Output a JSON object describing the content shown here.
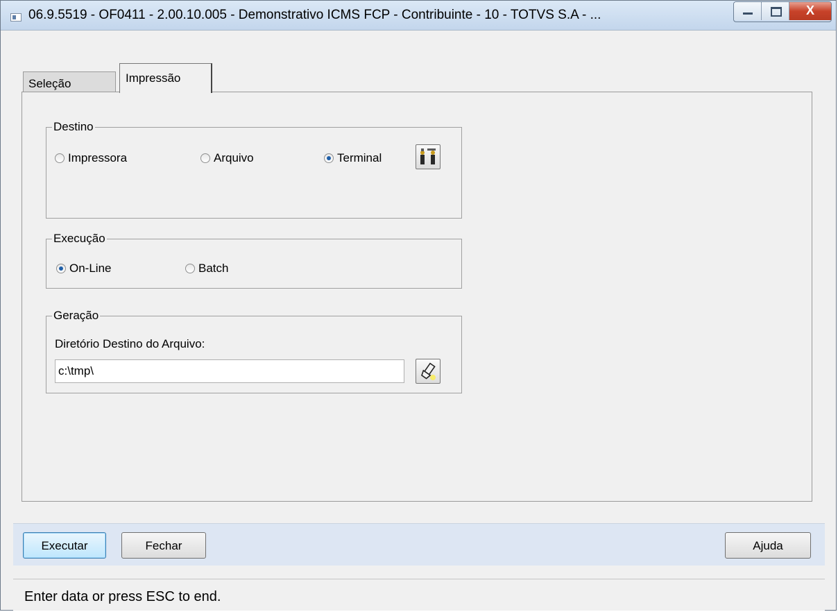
{
  "window": {
    "title": "06.9.5519 - OF0411 - 2.00.10.005 - Demonstrativo ICMS FCP - Contribuinte - 10 - TOTVS S.A - ...",
    "close_glyph": "X"
  },
  "tabs": [
    {
      "label": "Seleção"
    },
    {
      "label": "Impressão"
    }
  ],
  "destino": {
    "legend": "Destino",
    "options": [
      "Impressora",
      "Arquivo",
      "Terminal"
    ],
    "selected": "Terminal",
    "config_icon": "printer-setup-icon"
  },
  "execucao": {
    "legend": "Execução",
    "options": [
      "On-Line",
      "Batch"
    ],
    "selected": "On-Line"
  },
  "geracao": {
    "legend": "Geração",
    "field_label": "Diretório Destino do Arquivo:",
    "directory_value": "c:\\tmp\\",
    "browse_icon": "flashlight-search-icon"
  },
  "buttons": {
    "execute": "Executar",
    "close": "Fechar",
    "help": "Ajuda"
  },
  "status": "Enter data or press ESC to end.",
  "colors": {
    "bottom_bar": "#dde6f3",
    "default_button": "#bee6fd",
    "radio_selected": "#1f5fa8"
  }
}
